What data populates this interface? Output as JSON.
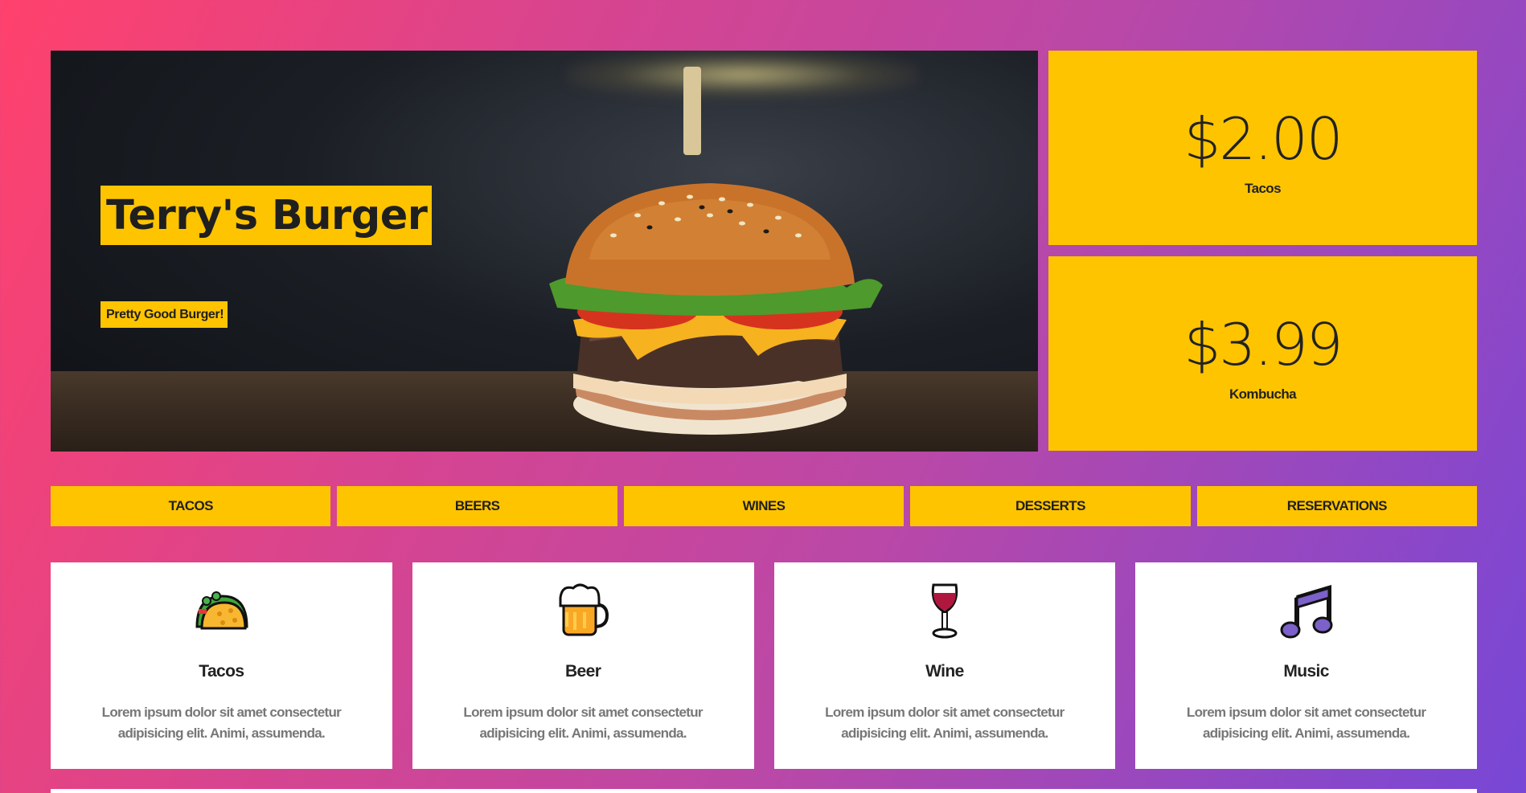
{
  "hero": {
    "title": "Terry's Burger",
    "subtitle": "Pretty Good Burger!"
  },
  "prices": [
    {
      "amount": "$2.00",
      "label": "Tacos"
    },
    {
      "amount": "$3.99",
      "label": "Kombucha"
    }
  ],
  "nav": {
    "items": [
      {
        "label": "TACOS"
      },
      {
        "label": "BEERS"
      },
      {
        "label": "WINES"
      },
      {
        "label": "DESSERTS"
      },
      {
        "label": "RESERVATIONS"
      }
    ]
  },
  "features": [
    {
      "icon": "taco-icon",
      "title": "Tacos",
      "text": "Lorem ipsum dolor sit amet consectetur adipisicing elit. Animi, assumenda."
    },
    {
      "icon": "beer-icon",
      "title": "Beer",
      "text": "Lorem ipsum dolor sit amet consectetur adipisicing elit. Animi, assumenda."
    },
    {
      "icon": "wine-icon",
      "title": "Wine",
      "text": "Lorem ipsum dolor sit amet consectetur adipisicing elit. Animi, assumenda."
    },
    {
      "icon": "music-icon",
      "title": "Music",
      "text": "Lorem ipsum dolor sit amet consectetur adipisicing elit. Animi, assumenda."
    }
  ],
  "colors": {
    "accent": "#ffc400",
    "gradient_start": "#ff416c",
    "gradient_end": "#7747d6"
  }
}
